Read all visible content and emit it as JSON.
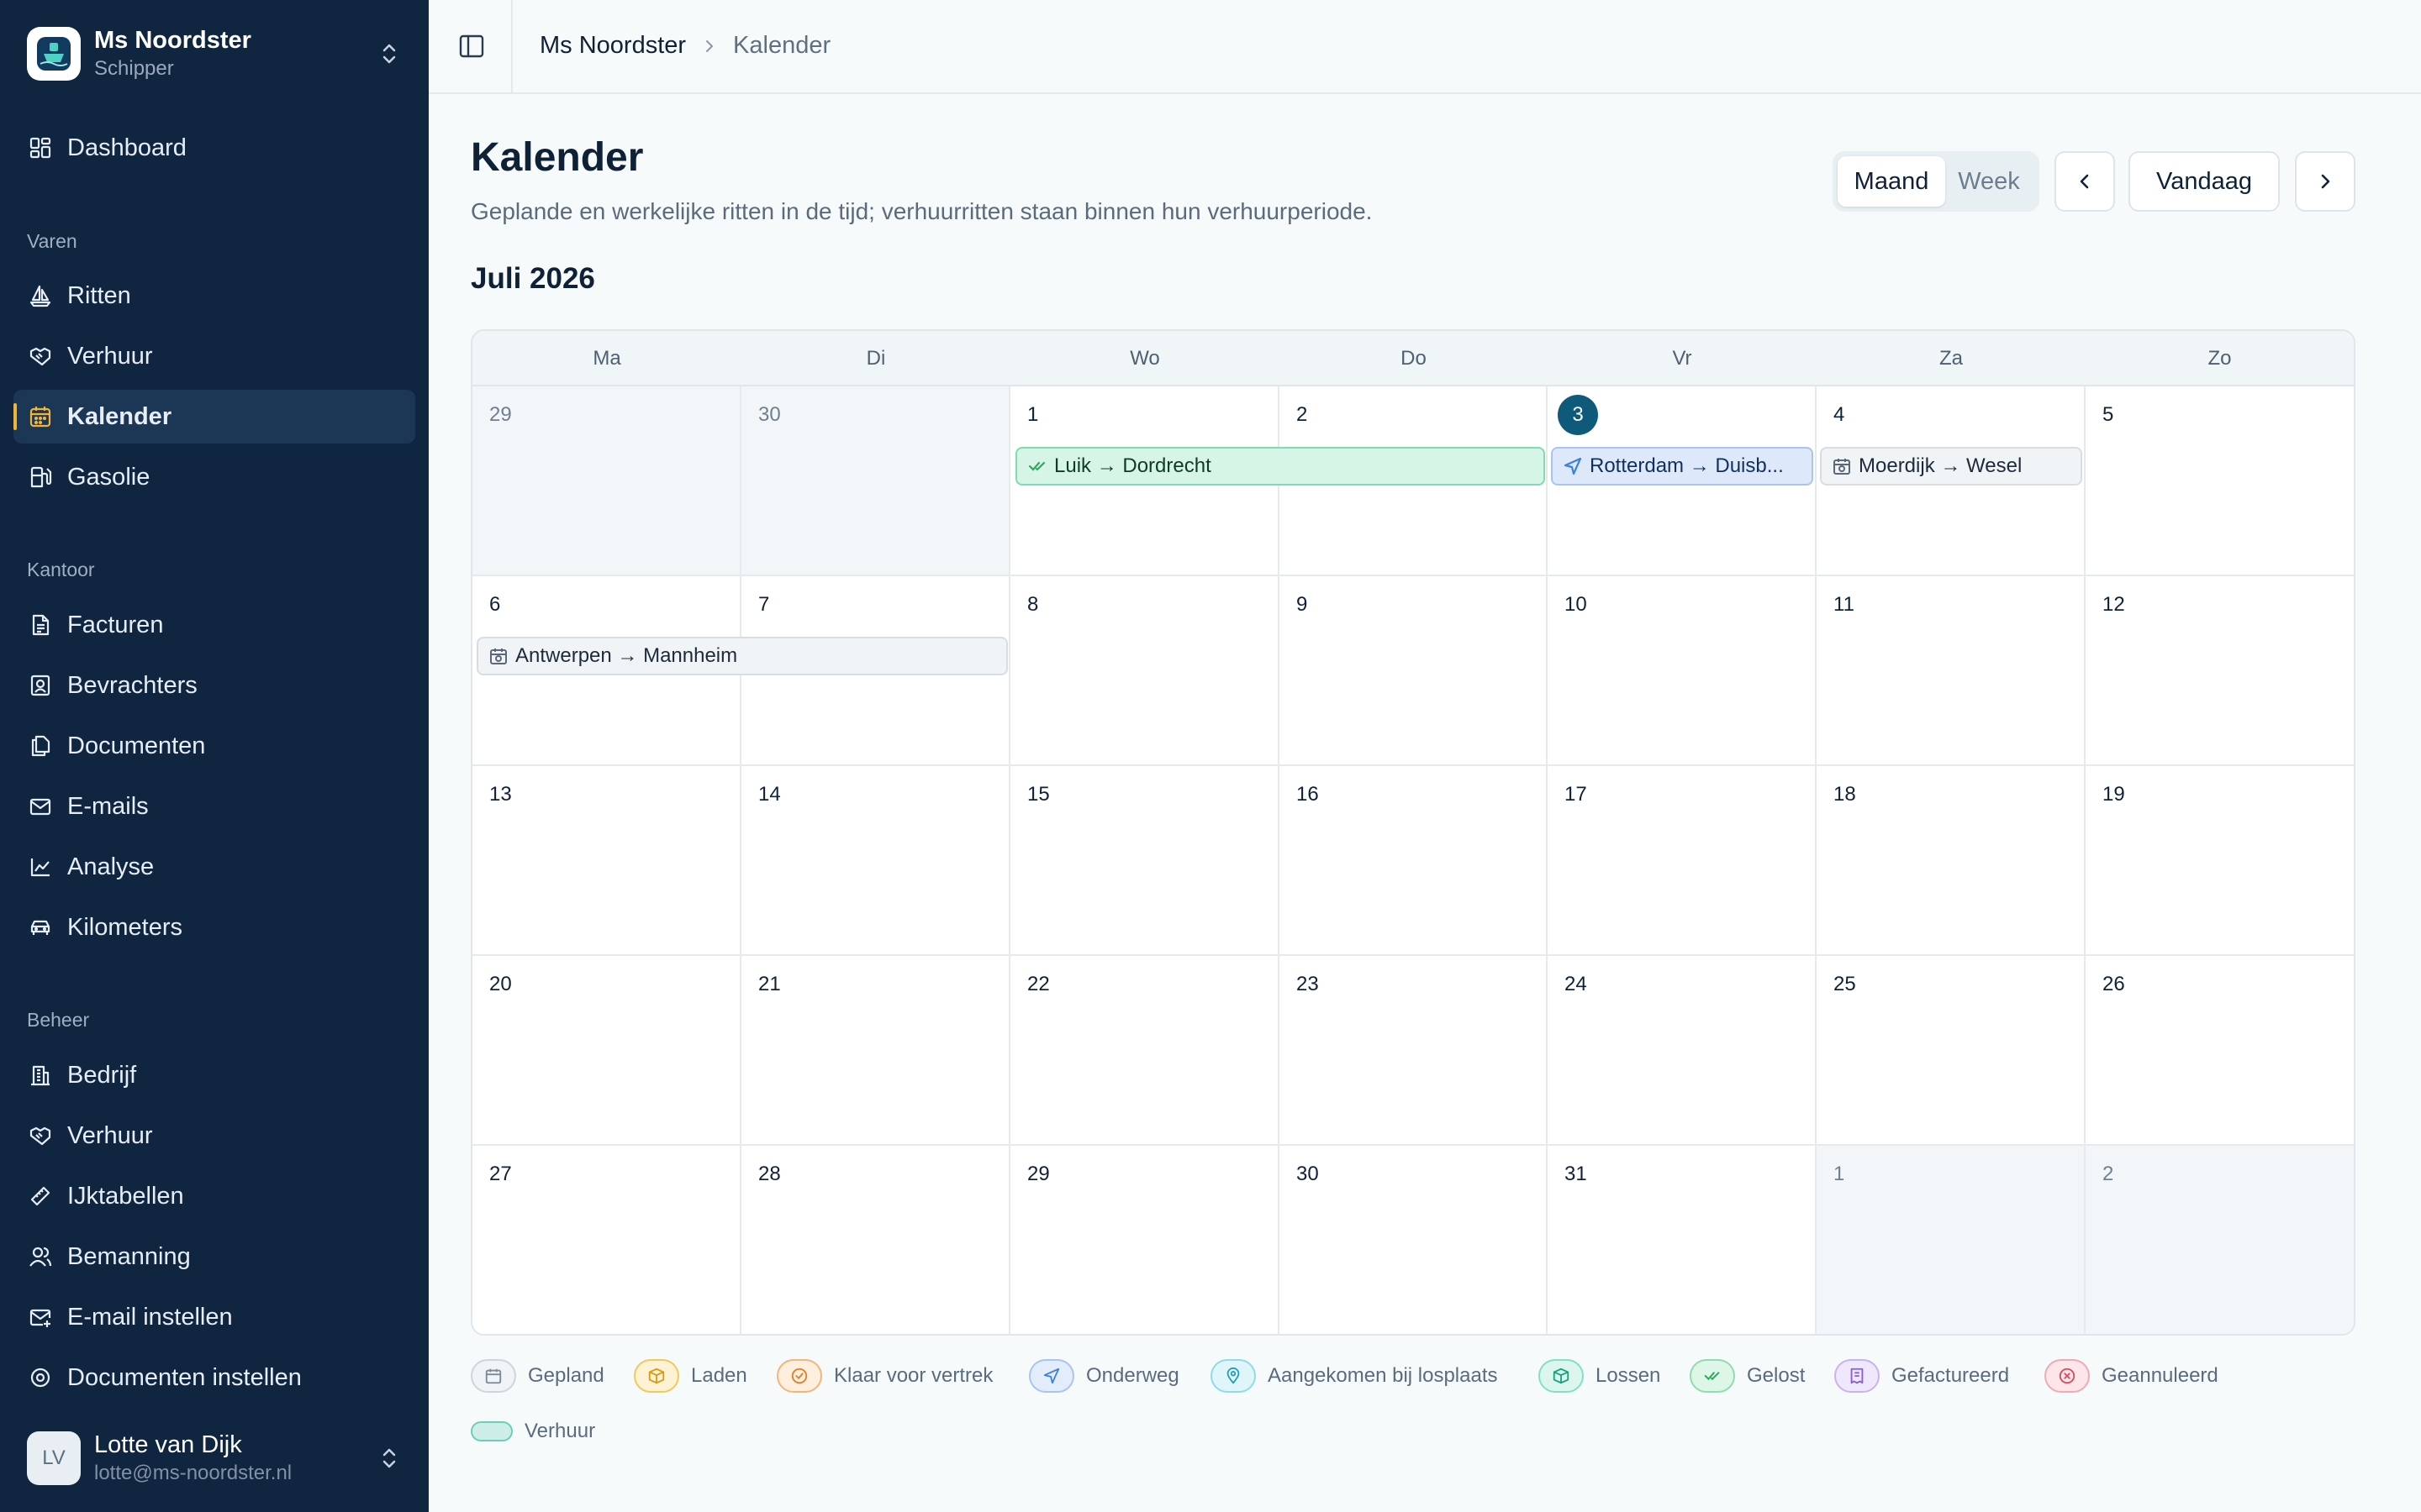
{
  "ship": {
    "name": "Ms Noordster",
    "role": "Schipper"
  },
  "nav": {
    "dashboard": "Dashboard",
    "groups": {
      "varen": "Varen",
      "kantoor": "Kantoor",
      "beheer": "Beheer"
    },
    "varen": [
      "Ritten",
      "Verhuur",
      "Kalender",
      "Gasolie"
    ],
    "kantoor": [
      "Facturen",
      "Bevrachters",
      "Documenten",
      "E-mails",
      "Analyse",
      "Kilometers"
    ],
    "beheer": [
      "Bedrijf",
      "Verhuur",
      "IJktabellen",
      "Bemanning",
      "E-mail instellen",
      "Documenten instellen"
    ],
    "active": "Kalender"
  },
  "user": {
    "initials": "LV",
    "name": "Lotte van Dijk",
    "email": "lotte@ms-noordster.nl"
  },
  "breadcrumb": {
    "ship": "Ms Noordster",
    "current": "Kalender"
  },
  "header": {
    "title": "Kalender",
    "subtitle": "Geplande en werkelijke ritten in de tijd; verhuurritten staan binnen hun verhuurperiode.",
    "month": "Juli 2026"
  },
  "controls": {
    "view_month": "Maand",
    "view_week": "Week",
    "today": "Vandaag"
  },
  "calendar": {
    "weekdays": [
      "Ma",
      "Di",
      "Wo",
      "Do",
      "Vr",
      "Za",
      "Zo"
    ],
    "weeks": [
      [
        "29",
        "30",
        "1",
        "2",
        "3",
        "4",
        "5"
      ],
      [
        "6",
        "7",
        "8",
        "9",
        "10",
        "11",
        "12"
      ],
      [
        "13",
        "14",
        "15",
        "16",
        "17",
        "18",
        "19"
      ],
      [
        "20",
        "21",
        "22",
        "23",
        "24",
        "25",
        "26"
      ],
      [
        "27",
        "28",
        "29",
        "30",
        "31",
        "1",
        "2"
      ]
    ],
    "today": "3",
    "events": [
      {
        "label": "Luik → Dordrecht",
        "status": "Gelost"
      },
      {
        "label": "Rotterdam → Duisb...",
        "status": "Onderweg"
      },
      {
        "label": "Moerdijk → Wesel",
        "status": "Gepland"
      },
      {
        "label": "Antwerpen → Mannheim",
        "status": "Gepland"
      }
    ]
  },
  "legend": [
    {
      "label": "Gepland",
      "icon": "calendar-icon",
      "color": "#8a97a6"
    },
    {
      "label": "Laden",
      "icon": "package-icon",
      "color": "#e0a526"
    },
    {
      "label": "Klaar voor vertrek",
      "icon": "check-circle-icon",
      "color": "#e58b3a"
    },
    {
      "label": "Onderweg",
      "icon": "navigation-icon",
      "color": "#3f7fdb"
    },
    {
      "label": "Aangekomen bij losplaats",
      "icon": "map-pin-icon",
      "color": "#22a7c2"
    },
    {
      "label": "Lossen",
      "icon": "box-icon",
      "color": "#1bb38a"
    },
    {
      "label": "Gelost",
      "icon": "double-check-icon",
      "color": "#2eaa62"
    },
    {
      "label": "Gefactureerd",
      "icon": "receipt-icon",
      "color": "#8a5cd6"
    },
    {
      "label": "Geannuleerd",
      "icon": "x-circle-icon",
      "color": "#d94a5c"
    },
    {
      "label": "Verhuur",
      "icon": "rental-pill",
      "color": "#6fcdb5"
    }
  ]
}
